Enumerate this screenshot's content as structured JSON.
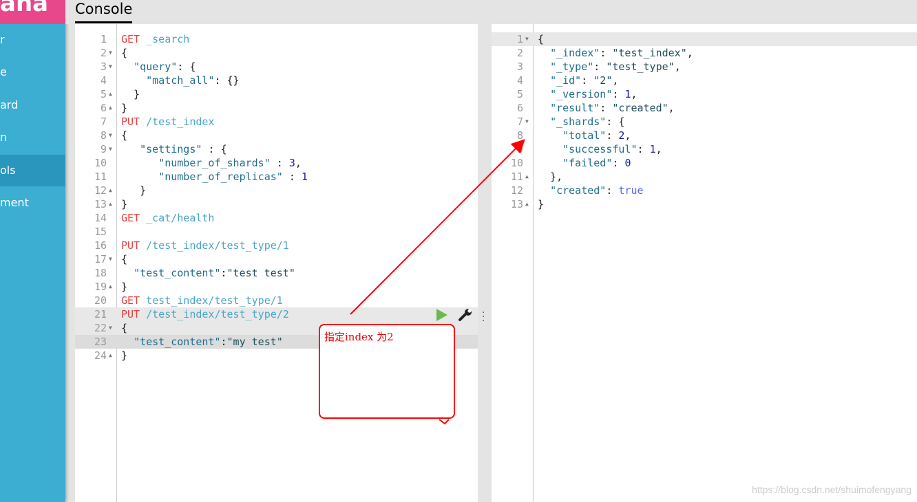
{
  "sidebar": {
    "brand": "ana",
    "items": [
      {
        "label": "r"
      },
      {
        "label": "e"
      },
      {
        "label": "ard"
      },
      {
        "label": "n"
      },
      {
        "label": "ols",
        "selected": true
      },
      {
        "label": "ment"
      }
    ]
  },
  "tab": {
    "label": "Console"
  },
  "request_lines": [
    [
      [
        "m",
        "GET"
      ],
      [
        "p",
        " "
      ],
      [
        "u",
        "_search"
      ]
    ],
    [
      [
        "p",
        "{"
      ]
    ],
    [
      [
        "p",
        "  "
      ],
      [
        "k",
        "\"query\""
      ],
      [
        "p",
        ": {"
      ]
    ],
    [
      [
        "p",
        "    "
      ],
      [
        "k",
        "\"match_all\""
      ],
      [
        "p",
        ": {}"
      ]
    ],
    [
      [
        "p",
        "  }"
      ]
    ],
    [
      [
        "p",
        "}"
      ]
    ],
    [
      [
        "m",
        "PUT"
      ],
      [
        "p",
        " "
      ],
      [
        "u",
        "/test_index"
      ]
    ],
    [
      [
        "p",
        "{"
      ]
    ],
    [
      [
        "p",
        "   "
      ],
      [
        "k",
        "\"settings\""
      ],
      [
        "p",
        " : {"
      ]
    ],
    [
      [
        "p",
        "      "
      ],
      [
        "k",
        "\"number_of_shards\""
      ],
      [
        "p",
        " : "
      ],
      [
        "n",
        "3"
      ],
      [
        "p",
        ","
      ]
    ],
    [
      [
        "p",
        "      "
      ],
      [
        "k",
        "\"number_of_replicas\""
      ],
      [
        "p",
        " : "
      ],
      [
        "n",
        "1"
      ]
    ],
    [
      [
        "p",
        "   }"
      ]
    ],
    [
      [
        "p",
        "}"
      ]
    ],
    [
      [
        "m",
        "GET"
      ],
      [
        "p",
        " "
      ],
      [
        "u",
        "_cat/health"
      ]
    ],
    [],
    [
      [
        "m",
        "PUT"
      ],
      [
        "p",
        " "
      ],
      [
        "u",
        "/test_index/test_type/1"
      ]
    ],
    [
      [
        "p",
        "{"
      ]
    ],
    [
      [
        "p",
        "  "
      ],
      [
        "k",
        "\"test_content\""
      ],
      [
        "p",
        ":"
      ],
      [
        "s",
        "\"test test\""
      ]
    ],
    [
      [
        "p",
        "}"
      ]
    ],
    [
      [
        "m",
        "GET"
      ],
      [
        "p",
        " "
      ],
      [
        "u",
        "test_index/test_type/1"
      ]
    ],
    [
      [
        "m",
        "PUT"
      ],
      [
        "p",
        " "
      ],
      [
        "u",
        "/test_index/test_type/2"
      ]
    ],
    [
      [
        "p",
        "{"
      ]
    ],
    [
      [
        "p",
        "  "
      ],
      [
        "k",
        "\"test_content\""
      ],
      [
        "p",
        ":"
      ],
      [
        "s",
        "\"my test\""
      ]
    ],
    [
      [
        "p",
        "}"
      ]
    ]
  ],
  "request_folds": {
    "2": "down",
    "3": "down",
    "5": "up",
    "6": "up",
    "8": "down",
    "9": "down",
    "12": "up",
    "13": "up",
    "17": "down",
    "19": "up",
    "22": "down",
    "24": "up"
  },
  "response_lines": [
    [
      [
        "p",
        "{"
      ]
    ],
    [
      [
        "p",
        "  "
      ],
      [
        "k",
        "\"_index\""
      ],
      [
        "p",
        ": "
      ],
      [
        "s",
        "\"test_index\""
      ],
      [
        "p",
        ","
      ]
    ],
    [
      [
        "p",
        "  "
      ],
      [
        "k",
        "\"_type\""
      ],
      [
        "p",
        ": "
      ],
      [
        "s",
        "\"test_type\""
      ],
      [
        "p",
        ","
      ]
    ],
    [
      [
        "p",
        "  "
      ],
      [
        "k",
        "\"_id\""
      ],
      [
        "p",
        ": "
      ],
      [
        "s",
        "\"2\""
      ],
      [
        "p",
        ","
      ]
    ],
    [
      [
        "p",
        "  "
      ],
      [
        "k",
        "\"_version\""
      ],
      [
        "p",
        ": "
      ],
      [
        "n",
        "1"
      ],
      [
        "p",
        ","
      ]
    ],
    [
      [
        "p",
        "  "
      ],
      [
        "k",
        "\"result\""
      ],
      [
        "p",
        ": "
      ],
      [
        "s",
        "\"created\""
      ],
      [
        "p",
        ","
      ]
    ],
    [
      [
        "p",
        "  "
      ],
      [
        "k",
        "\"_shards\""
      ],
      [
        "p",
        ": {"
      ]
    ],
    [
      [
        "p",
        "    "
      ],
      [
        "k",
        "\"total\""
      ],
      [
        "p",
        ": "
      ],
      [
        "n",
        "2"
      ],
      [
        "p",
        ","
      ]
    ],
    [
      [
        "p",
        "    "
      ],
      [
        "k",
        "\"successful\""
      ],
      [
        "p",
        ": "
      ],
      [
        "n",
        "1"
      ],
      [
        "p",
        ","
      ]
    ],
    [
      [
        "p",
        "    "
      ],
      [
        "k",
        "\"failed\""
      ],
      [
        "p",
        ": "
      ],
      [
        "n",
        "0"
      ]
    ],
    [
      [
        "p",
        "  },"
      ]
    ],
    [
      [
        "p",
        "  "
      ],
      [
        "k",
        "\"created\""
      ],
      [
        "p",
        ": "
      ],
      [
        "b",
        "true"
      ]
    ],
    [
      [
        "p",
        "}"
      ]
    ]
  ],
  "response_folds": {
    "1": "down",
    "7": "down",
    "11": "up",
    "13": "up"
  },
  "actions": {
    "run": "play-icon",
    "settings": "wrench-icon",
    "more": "vertical-dots-icon"
  },
  "annotation": {
    "text": "指定index 为2",
    "color": "#ff0000"
  },
  "watermark": "https://blog.csdn.net/shuimofengyang"
}
